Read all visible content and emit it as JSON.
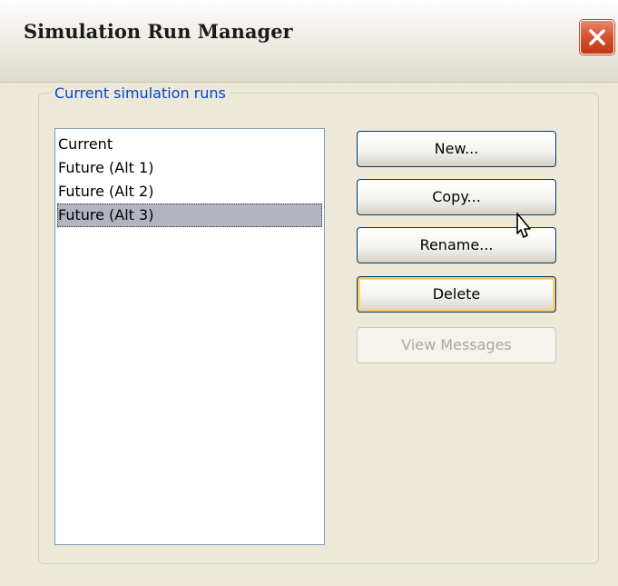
{
  "window": {
    "title": "Simulation Run Manager"
  },
  "group": {
    "label": "Current simulation runs"
  },
  "runs": {
    "items": [
      {
        "label": "Current",
        "selected": false
      },
      {
        "label": "Future (Alt 1)",
        "selected": false
      },
      {
        "label": "Future (Alt 2)",
        "selected": false
      },
      {
        "label": "Future (Alt 3)",
        "selected": true
      }
    ]
  },
  "buttons": {
    "new_label": "New...",
    "copy_label": "Copy...",
    "rename_label": "Rename...",
    "delete_label": "Delete",
    "view_messages_label": "View Messages"
  },
  "colors": {
    "group_label": "#0046d5",
    "selection": "#b2b4bf",
    "close_button": "#d4522f"
  }
}
